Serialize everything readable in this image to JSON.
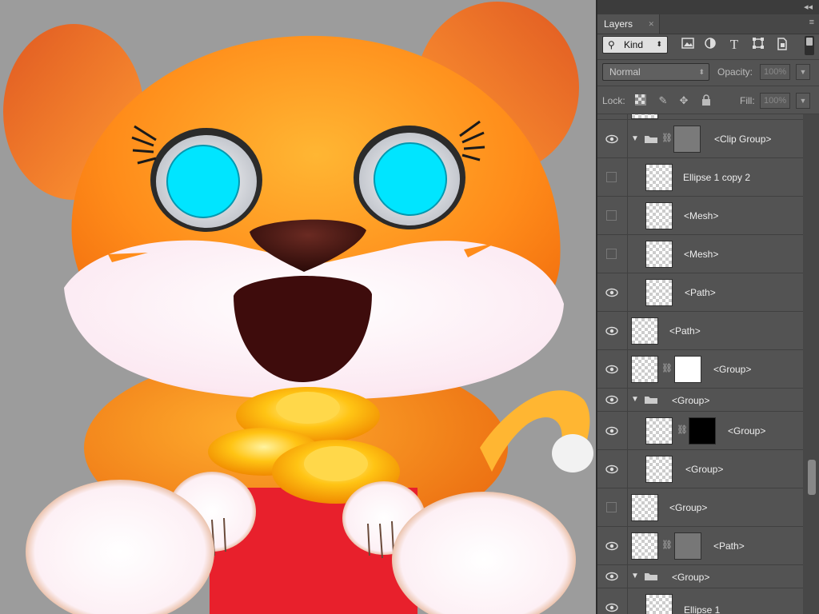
{
  "panel": {
    "tab_label": "Layers",
    "collapse_glyph": "◂◂",
    "menu_glyph": "≡",
    "tab_close_glyph": "✕",
    "filter": {
      "kind_label": "Kind",
      "filter_icons": [
        "image-filter-icon",
        "adjustment-filter-icon",
        "type-filter-icon",
        "shape-filter-icon",
        "smart-object-filter-icon"
      ]
    },
    "blend_mode": "Normal",
    "opacity_label": "Opacity:",
    "opacity_value": "100%",
    "lock_label": "Lock:",
    "fill_label": "Fill:",
    "fill_value": "100%"
  },
  "layers": [
    {
      "name": "<Clip Group>",
      "visible": true,
      "type": "group-expanded",
      "indent": 0
    },
    {
      "name": "Ellipse 1 copy 2",
      "visible": false,
      "type": "layer",
      "indent": 1
    },
    {
      "name": "<Mesh>",
      "visible": false,
      "type": "layer",
      "indent": 1
    },
    {
      "name": "<Mesh>",
      "visible": false,
      "type": "layer",
      "indent": 1
    },
    {
      "name": "<Path>",
      "visible": true,
      "type": "layer",
      "indent": 1
    },
    {
      "name": "<Path>",
      "visible": true,
      "type": "layer",
      "indent": 0
    },
    {
      "name": "<Group>",
      "visible": true,
      "type": "masked-layer",
      "indent": 0
    },
    {
      "name": "<Group>",
      "visible": true,
      "type": "group-expanded",
      "indent": 0
    },
    {
      "name": "<Group>",
      "visible": true,
      "type": "masked-layer",
      "indent": 1
    },
    {
      "name": "<Group>",
      "visible": true,
      "type": "layer",
      "indent": 1
    },
    {
      "name": "<Group>",
      "visible": false,
      "type": "layer",
      "indent": 0
    },
    {
      "name": "<Path>",
      "visible": true,
      "type": "masked-layer",
      "indent": 0
    },
    {
      "name": "<Group>",
      "visible": true,
      "type": "group-expanded",
      "indent": 0
    },
    {
      "name": "Ellipse 1",
      "visible": true,
      "type": "layer",
      "indent": 1
    }
  ],
  "colors": {
    "canvas_bg": "#9c9c9c",
    "panel_bg": "#535353",
    "tiger_orange": "#ff8c1a",
    "eye_cyan": "#00e5ff",
    "red_envelope": "#e8202c",
    "gold": "#ffc414"
  }
}
